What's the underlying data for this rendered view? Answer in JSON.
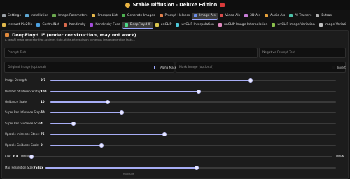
{
  "window": {
    "title": "Stable Diffusion - Deluxe Edition"
  },
  "main_tabs": [
    {
      "label": "Settings",
      "icon": "gear-icon",
      "color": "#9aa0a6"
    },
    {
      "label": "Installation",
      "icon": "download-icon",
      "color": "#5fa8d3"
    },
    {
      "label": "Image Parameters",
      "icon": "image-params-icon",
      "color": "#6aa84f"
    },
    {
      "label": "Prompts List",
      "icon": "list-icon",
      "color": "#e6b84c"
    },
    {
      "label": "Generate Images",
      "icon": "image-icon",
      "color": "#4caf50"
    },
    {
      "label": "Prompt Helpers",
      "icon": "helper-icon",
      "color": "#e0804c"
    },
    {
      "label": "Image AIs",
      "icon": "image-ai-icon",
      "color": "#6c8ee8",
      "active": true
    },
    {
      "label": "Video AIs",
      "icon": "video-icon",
      "color": "#d84c4c"
    },
    {
      "label": "3D AIs",
      "icon": "cube-icon",
      "color": "#c77dd6"
    },
    {
      "label": "Audio AIs",
      "icon": "audio-icon",
      "color": "#e6a23c"
    },
    {
      "label": "AI Trainers",
      "icon": "trainer-icon",
      "color": "#4cc0a8"
    },
    {
      "label": "Extras",
      "icon": "extras-icon",
      "color": "#b0b0b0"
    }
  ],
  "sub_tabs": [
    {
      "label": "Instruct Pix2Pix",
      "icon": "pix2pix-icon",
      "color": "#e0b84c"
    },
    {
      "label": "ControlNet",
      "icon": "controlnet-icon",
      "color": "#4ca0e0"
    },
    {
      "label": "Kandinsky",
      "icon": "kandinsky-icon",
      "color": "#d86a4c"
    },
    {
      "label": "Kandinsky Fuse",
      "icon": "fuse-icon",
      "color": "#a24cd8"
    },
    {
      "label": "DeepFloyd IF",
      "icon": "deepfloyd-icon",
      "color": "#4cd88a",
      "active": true
    },
    {
      "label": "unCLIP",
      "icon": "unclip-icon",
      "color": "#d8c44c"
    },
    {
      "label": "unCLIP Interpolation",
      "icon": "interp-icon",
      "color": "#4cc8d8"
    },
    {
      "label": "unCLIP Image Interpolation",
      "icon": "img-interp-icon",
      "color": "#e08ac0"
    },
    {
      "label": "unCLIP Image Variation",
      "icon": "variation-icon",
      "color": "#8ac04c"
    },
    {
      "label": "Image Variati",
      "icon": "variation2-icon",
      "color": "#c0c0c0"
    }
  ],
  "section": {
    "title": "DeepFloyd IF (under construction, may not work)",
    "subtitle": "A new AI image generator that achieves state-of-the-art results on numerous image-generation tasks..."
  },
  "fields": {
    "prompt_placeholder": "Prompt Text",
    "negative_placeholder": "Negative Prompt Text",
    "original_image_placeholder": "Original Image (optional)",
    "mask_image_placeholder": "Mask Image (optional)",
    "alpha_mask_label": "Alpha Mask",
    "invert_label": "Invert"
  },
  "sliders": [
    {
      "label": "Image Strength:",
      "value": "0.7",
      "fraction": 0.7
    },
    {
      "label": "Number of Inference Steps:",
      "value": "100",
      "fraction": 0.52
    },
    {
      "label": "Guidance Scale:",
      "value": "10",
      "fraction": 0.2
    },
    {
      "label": "Super Res Inference Steps:",
      "value": "50",
      "fraction": 0.25
    },
    {
      "label": "Super Res Guidance Scale:",
      "value": "4",
      "fraction": 0.08
    },
    {
      "label": "Upscale Inference Steps:",
      "value": "75",
      "fraction": 0.4
    },
    {
      "label": "Upscale Guidance Scale:",
      "value": "9",
      "fraction": 0.18
    }
  ],
  "eta": {
    "label": "ETA:",
    "value": "0.0",
    "min_label": "DDIM",
    "max_label": "DDPM",
    "fraction": 0.0
  },
  "max_resolution": {
    "label": "Max Resolution Size:",
    "value": "768px",
    "fraction": 0.52
  },
  "footer_note": "Multi Size"
}
